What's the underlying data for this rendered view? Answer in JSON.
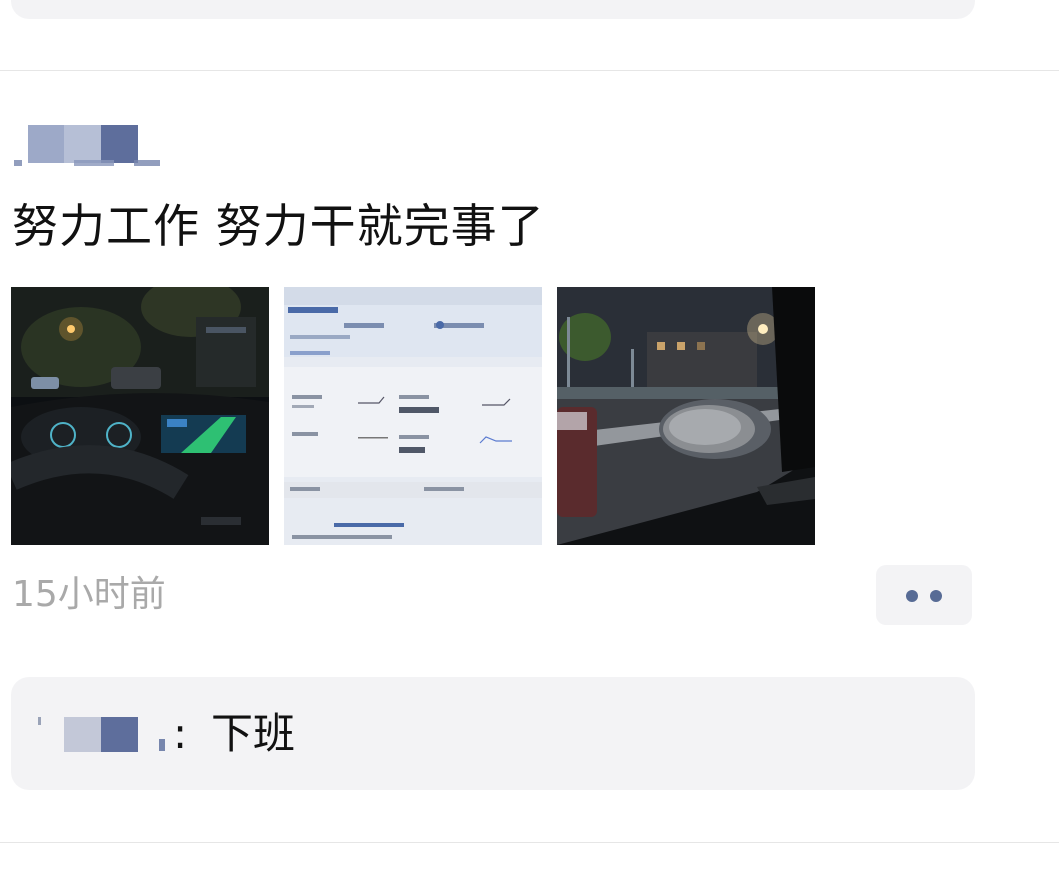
{
  "post": {
    "text": "努力工作 努力干就完事了",
    "time": "15小时前",
    "photos": [
      {
        "name": "car-dashboard-night-photo"
      },
      {
        "name": "computer-screen-dashboard-photo"
      },
      {
        "name": "side-mirror-street-night-photo"
      }
    ]
  },
  "comment": {
    "colon": ":",
    "text": "下班"
  },
  "colors": {
    "name_link": "#576b95",
    "card_bg": "#f3f3f5",
    "time_gray": "#a9a9a9"
  },
  "icons": {
    "more": "more-dots-icon"
  }
}
